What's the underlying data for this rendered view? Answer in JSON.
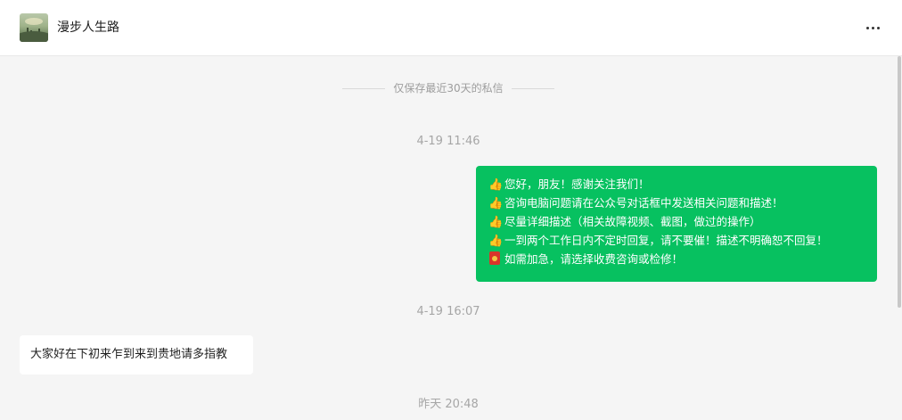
{
  "header": {
    "title": "漫步人生路",
    "avatar_icon": "landscape-avatar",
    "more_icon": "more-dots-icon"
  },
  "chat": {
    "notice": "仅保存最近30天的私信",
    "timestamps": [
      "4-19 11:46",
      "4-19 16:07",
      "昨天 20:48"
    ],
    "outgoing": {
      "lines": [
        {
          "icon": "thumbs-up-icon",
          "glyph": "👍",
          "text": "您好，朋友！感谢关注我们！"
        },
        {
          "icon": "thumbs-up-icon",
          "glyph": "👍",
          "text": "咨询电脑问题请在公众号对话框中发送相关问题和描述！"
        },
        {
          "icon": "thumbs-up-icon",
          "glyph": "👍",
          "text": "尽量详细描述（相关故障视频、截图，做过的操作）"
        },
        {
          "icon": "thumbs-up-icon",
          "glyph": "👍",
          "text": "一到两个工作日内不定时回复，请不要催！描述不明确恕不回复！"
        },
        {
          "icon": "red-packet-icon",
          "glyph": "",
          "text": "如需加急，请选择收费咨询或检修！"
        }
      ]
    },
    "incoming": {
      "text": "大家好在下初来乍到来到贵地请多指教"
    }
  },
  "colors": {
    "accent_green": "#07c160",
    "chat_background": "#f5f5f5",
    "timestamp_gray": "#a6a6a6"
  }
}
